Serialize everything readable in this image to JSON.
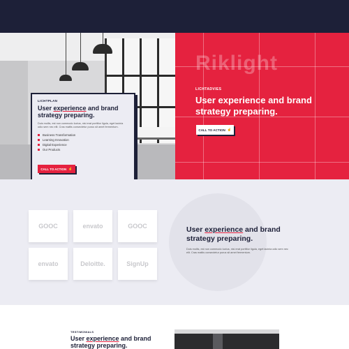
{
  "hero": {
    "brand_watermark": "Riklight",
    "eyebrow": "LICHTADVIES",
    "title": "User experience and brand strategy preparing.",
    "cta_label": "CALL TO ACTION",
    "cta_icon": "hand-pointer-icon"
  },
  "card": {
    "eyebrow": "LICHTPLAN",
    "title_pre": "User ",
    "title_underlined": "experience",
    "title_post": " and brand strategy preparing.",
    "paragraph": "Duis mollis, est non commodo luctus, nisi erat porttitor ligula, eget lacinia odio sem nec elit. Cras mattis consectetur purus sit amet fermentum.",
    "list": [
      "Business Transformation",
      "Learning Innovation",
      "Digital Experience",
      "Our Products"
    ],
    "cta_label": "CALL TO ACTION",
    "accent": "#e5223f"
  },
  "clients": {
    "logos": [
      "GOOC",
      "envato",
      "GOOC",
      "envato",
      "Deloitte.",
      "SignUp"
    ],
    "title_pre": "User ",
    "title_underlined": "experience",
    "title_post": " and brand strategy preparing.",
    "paragraph": "Duis mollis, est non commodo luctus, nisi erat porttitor ligula, eget lacinia odio sem nec elit. Cras mattis consectetur purus sit amet fermentum."
  },
  "testimonials": {
    "eyebrow": "TESTIMONIALS",
    "title_pre": "User ",
    "title_underlined": "experience",
    "title_post": " and brand strategy preparing."
  },
  "colors": {
    "navy": "#1d2038",
    "red": "#e5223f",
    "light": "#ececf3"
  }
}
